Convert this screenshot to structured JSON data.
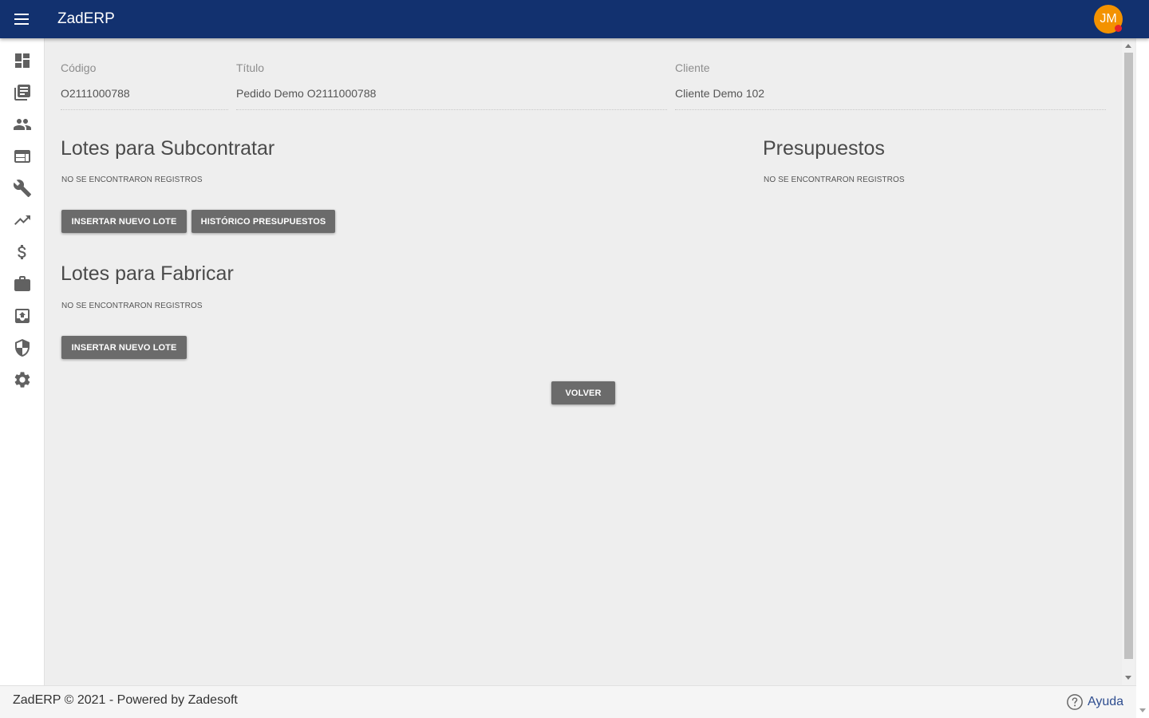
{
  "app": {
    "title": "ZadERP",
    "user_initials": "JM"
  },
  "sidebar": {
    "items": [
      {
        "icon": "dashboard-icon"
      },
      {
        "icon": "library-books-icon"
      },
      {
        "icon": "people-icon"
      },
      {
        "icon": "web-window-icon"
      },
      {
        "icon": "wrench-icon"
      },
      {
        "icon": "trending-up-icon"
      },
      {
        "icon": "dollar-icon"
      },
      {
        "icon": "briefcase-icon"
      },
      {
        "icon": "archive-upload-icon"
      },
      {
        "icon": "shield-icon"
      },
      {
        "icon": "gear-icon"
      }
    ]
  },
  "order": {
    "code_label": "Código",
    "code_value": "O2111000788",
    "title_label": "Título",
    "title_value": "Pedido Demo O2111000788",
    "client_label": "Cliente",
    "client_value": "Cliente Demo 102"
  },
  "subcontract": {
    "title": "Lotes para Subcontratar",
    "empty": "NO SE ENCONTRARON REGISTROS",
    "insert_button": "INSERTAR NUEVO LOTE",
    "history_button": "HISTÓRICO PRESUPUESTOS"
  },
  "budgets": {
    "title": "Presupuestos",
    "empty": "NO SE ENCONTRARON REGISTROS"
  },
  "manufacture": {
    "title": "Lotes para Fabricar",
    "empty": "NO SE ENCONTRARON REGISTROS",
    "insert_button": "INSERTAR NUEVO LOTE"
  },
  "back_button": "VOLVER",
  "footer": {
    "text": "ZadERP © 2021 - Powered by Zadesoft",
    "help": "Ayuda"
  },
  "colors": {
    "header": "#12316f",
    "avatar": "#f39200",
    "button": "#6b6b6b",
    "background": "#eeeeee"
  }
}
